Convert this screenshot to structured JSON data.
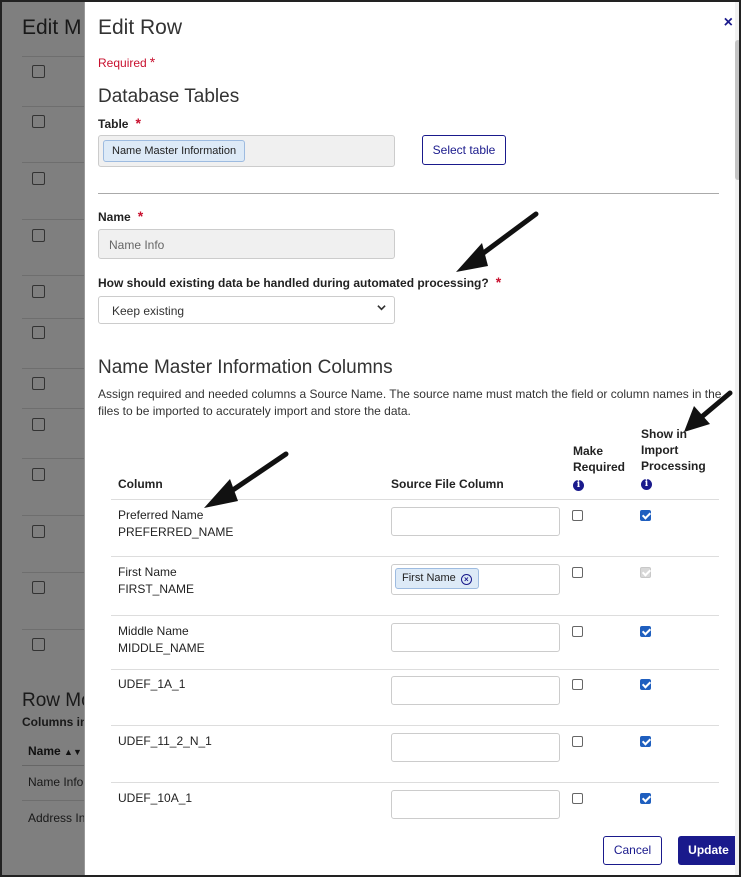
{
  "background": {
    "title": "Edit M",
    "sub_title": "Row Mo",
    "sub_label": "Columns in",
    "column_header": "Name",
    "rows": [
      "Name Info",
      "Address In"
    ]
  },
  "modal": {
    "title": "Edit Row",
    "close_icon": "×",
    "required_note": "Required",
    "star": "*",
    "database_tables_title": "Database Tables",
    "table_label": "Table",
    "table_value": "Name Master Information",
    "select_table_button": "Select table",
    "name_label": "Name",
    "name_value": "Name Info",
    "handling_label": "How should existing data be handled during automated processing?",
    "handling_value": "Keep existing",
    "columns_title": "Name Master Information Columns",
    "columns_description": "Assign required and needed columns a Source Name. The source name must match the field or column names in the files to be imported to accurately import and store the data.",
    "headers": {
      "column": "Column",
      "source": "Source File Column",
      "make_required_1": "Make",
      "make_required_2": "Required",
      "show_1": "Show in",
      "show_2": "Import",
      "show_3": "Processing",
      "info": "i"
    },
    "rows": [
      {
        "name": "Preferred Name",
        "code": "PREFERRED_NAME",
        "source": "",
        "required": false,
        "show": true
      },
      {
        "name": "First Name",
        "code": "FIRST_NAME",
        "source": "First Name",
        "required": false,
        "show": true,
        "show_disabled": true
      },
      {
        "name": "Middle Name",
        "code": "MIDDLE_NAME",
        "source": "",
        "required": false,
        "show": true
      },
      {
        "name": "UDEF_1A_1",
        "code": "",
        "source": "",
        "required": false,
        "show": true
      },
      {
        "name": "UDEF_11_2_N_1",
        "code": "",
        "source": "",
        "required": false,
        "show": true
      },
      {
        "name": "UDEF_10A_1",
        "code": "",
        "source": "",
        "required": false,
        "show": true
      }
    ],
    "cancel_button": "Cancel",
    "update_button": "Update",
    "chip_remove": "×"
  },
  "colors": {
    "accent": "#1a1a8c",
    "required": "#c8102e",
    "chip_bg": "#ddeaf7",
    "checkbox_checked": "#1f5fbf"
  },
  "icons": [
    "close-icon",
    "chevron-down-icon",
    "info-icon",
    "remove-chip-icon",
    "annotation-arrow-icon"
  ]
}
